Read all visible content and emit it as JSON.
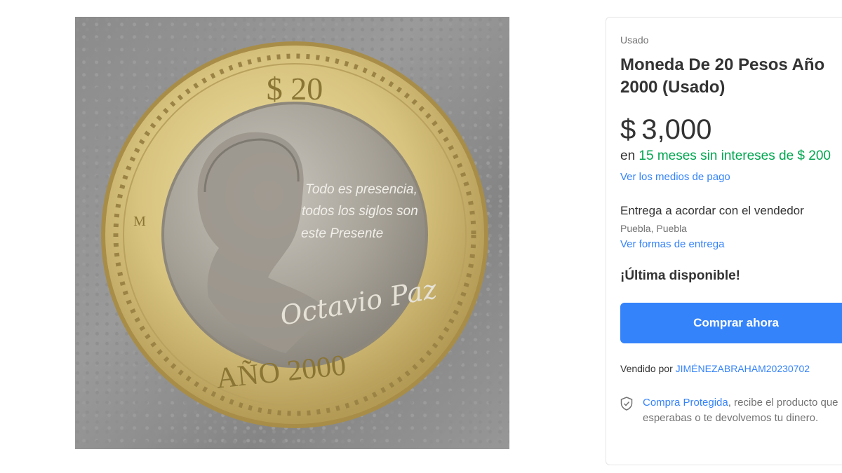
{
  "product": {
    "image_alt": "",
    "condition": "Usado",
    "title": "Moneda De 20 Pesos Año 2000 (Usado)",
    "currency_symbol": "$",
    "price": "3,000",
    "installments_prefix": "en",
    "installments_text": "15 meses sin intereses de $ 200",
    "payment_link": "Ver los medios de pago",
    "delivery": "Entrega a acordar con el vendedor",
    "location": "Puebla, Puebla",
    "delivery_link": "Ver formas de entrega",
    "stock": "¡Última disponible!",
    "buy_button": "Comprar ahora",
    "seller_prefix": "Vendido por",
    "seller_name": "JIMÉNEZABRAHAM20230702",
    "protected_link": "Compra Protegida",
    "protected_text": ", recibe el producto que esperabas o te devolvemos tu dinero."
  },
  "coin": {
    "denomination": "$ 20",
    "year_text": "AÑO 2000",
    "mint_mark": "M",
    "quote_line1": "Todo es presencia,",
    "quote_line2": "todos los siglos son",
    "quote_line3": "este Presente",
    "signature": "Octavio Paz"
  },
  "colors": {
    "accent": "#3483fa",
    "green": "#00a650",
    "coin_ring": "#d6c17a",
    "coin_center": "#a9a49c"
  },
  "icons": {
    "shield": "shield-check-icon"
  }
}
